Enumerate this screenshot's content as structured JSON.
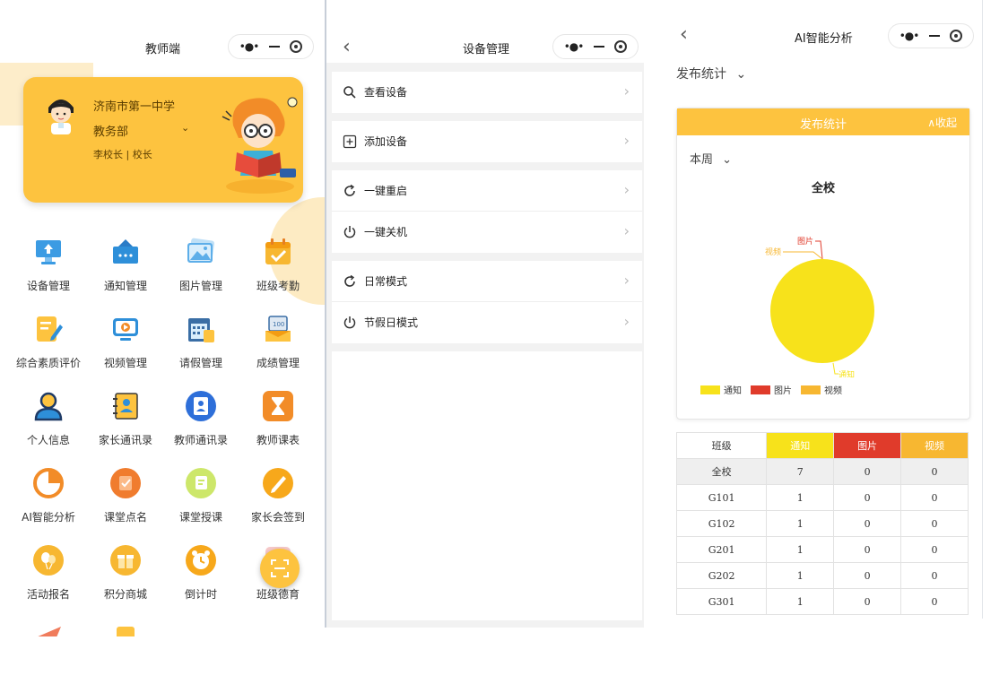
{
  "teacher_panel": {
    "title": "教师端",
    "profile": {
      "school": "济南市第一中学",
      "department": "教务部",
      "dept_chevron": "⌄",
      "person": "李校长 | 校长"
    },
    "grid": [
      {
        "label": "设备管理",
        "icon": "monitor-upload-icon"
      },
      {
        "label": "通知管理",
        "icon": "notice-board-icon"
      },
      {
        "label": "图片管理",
        "icon": "picture-icon"
      },
      {
        "label": "班级考勤",
        "icon": "calendar-check-icon"
      },
      {
        "label": "综合素质评价",
        "icon": "pencil-note-icon"
      },
      {
        "label": "视频管理",
        "icon": "video-play-icon"
      },
      {
        "label": "请假管理",
        "icon": "calendar-leave-icon"
      },
      {
        "label": "成绩管理",
        "icon": "score-card-icon"
      },
      {
        "label": "个人信息",
        "icon": "person-icon"
      },
      {
        "label": "家长通讯录",
        "icon": "contact-book-icon"
      },
      {
        "label": "教师通讯录",
        "icon": "teacher-contacts-icon"
      },
      {
        "label": "教师课表",
        "icon": "hourglass-icon"
      },
      {
        "label": "AI智能分析",
        "icon": "pie-chart-icon"
      },
      {
        "label": "课堂点名",
        "icon": "roll-call-icon"
      },
      {
        "label": "课堂授课",
        "icon": "lecture-icon"
      },
      {
        "label": "家长会签到",
        "icon": "sign-pen-icon"
      },
      {
        "label": "活动报名",
        "icon": "balloon-icon"
      },
      {
        "label": "积分商城",
        "icon": "gift-icon"
      },
      {
        "label": "倒计时",
        "icon": "alarm-clock-icon"
      },
      {
        "label": "班级德育",
        "icon": "moral-education-icon"
      }
    ]
  },
  "device_panel": {
    "title": "设备管理",
    "groups": [
      [
        {
          "label": "查看设备",
          "icon": "search-icon"
        }
      ],
      [
        {
          "label": "添加设备",
          "icon": "add-box-icon"
        }
      ],
      [
        {
          "label": "一键重启",
          "icon": "restart-icon"
        },
        {
          "label": "一键关机",
          "icon": "power-icon"
        }
      ],
      [
        {
          "label": "日常模式",
          "icon": "restart-icon"
        },
        {
          "label": "节假日模式",
          "icon": "power-icon"
        }
      ]
    ]
  },
  "analysis_panel": {
    "title": "AI智能分析",
    "filter": "发布统计",
    "filter_chevron": "⌄",
    "card_title": "发布统计",
    "collapse": "∧收起",
    "period": "本周",
    "period_chevron": "⌄",
    "colors": {
      "notice": "#f7e21b",
      "picture": "#e03b2b",
      "video": "#f7b731"
    },
    "chart_data": {
      "type": "pie",
      "title": "全校",
      "categories": [
        "通知",
        "图片",
        "视频"
      ],
      "values": [
        7,
        0,
        0
      ]
    },
    "table": {
      "headers": [
        "班级",
        "通知",
        "图片",
        "视频"
      ],
      "rows": [
        [
          "全校",
          "7",
          "0",
          "0"
        ],
        [
          "G101",
          "1",
          "0",
          "0"
        ],
        [
          "G102",
          "1",
          "0",
          "0"
        ],
        [
          "G201",
          "1",
          "0",
          "0"
        ],
        [
          "G202",
          "1",
          "0",
          "0"
        ],
        [
          "G301",
          "1",
          "0",
          "0"
        ]
      ]
    }
  }
}
